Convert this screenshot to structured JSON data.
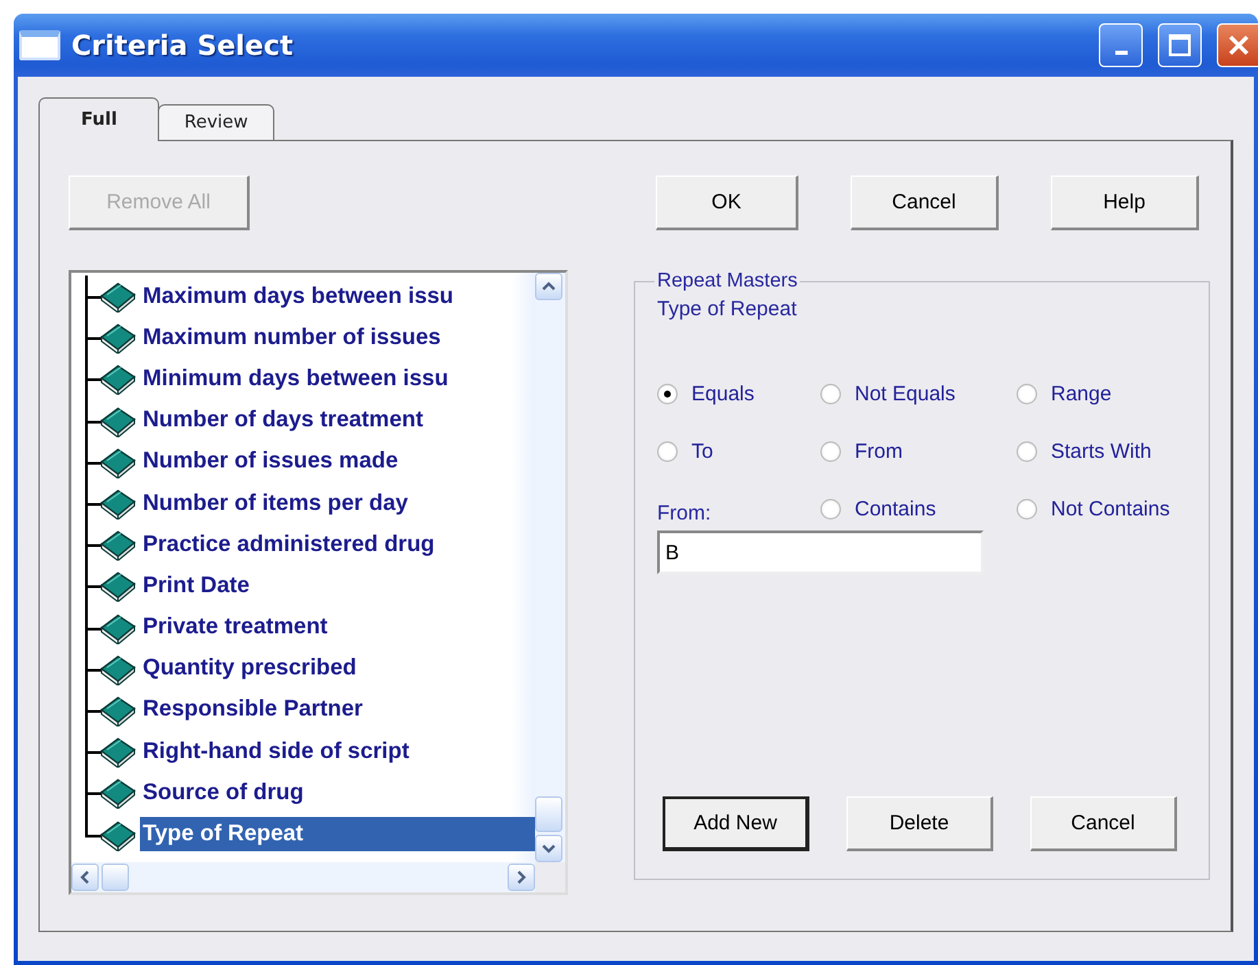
{
  "window": {
    "title": "Criteria Select"
  },
  "tabs": [
    {
      "label": "Full",
      "selected": true
    },
    {
      "label": "Review",
      "selected": false
    }
  ],
  "toolbar": {
    "remove_all": {
      "label": "Remove All",
      "disabled": true
    },
    "buttons": [
      "OK",
      "Cancel",
      "Help"
    ]
  },
  "tree": {
    "items": [
      {
        "label": "Maximum days between issu",
        "selected": false
      },
      {
        "label": "Maximum number of issues",
        "selected": false
      },
      {
        "label": "Minimum days between issu",
        "selected": false
      },
      {
        "label": "Number of days treatment",
        "selected": false
      },
      {
        "label": "Number of issues made",
        "selected": false
      },
      {
        "label": "Number of items per day",
        "selected": false
      },
      {
        "label": "Practice administered drug",
        "selected": false
      },
      {
        "label": "Print Date",
        "selected": false
      },
      {
        "label": "Private treatment",
        "selected": false
      },
      {
        "label": "Quantity prescribed",
        "selected": false
      },
      {
        "label": "Responsible Partner",
        "selected": false
      },
      {
        "label": "Right-hand side of script",
        "selected": false
      },
      {
        "label": "Source of drug",
        "selected": false
      },
      {
        "label": "Type of Repeat",
        "selected": true
      }
    ]
  },
  "group": {
    "title": "Repeat Masters",
    "subtitle": "Type of Repeat",
    "radio_columns": [
      [
        {
          "label": "Equals",
          "selected": true
        },
        {
          "label": "To",
          "selected": false
        }
      ],
      [
        {
          "label": "Not Equals",
          "selected": false
        },
        {
          "label": "From",
          "selected": false
        },
        {
          "label": "Contains",
          "selected": false
        }
      ],
      [
        {
          "label": "Range",
          "selected": false
        },
        {
          "label": "Starts With",
          "selected": false
        },
        {
          "label": "Not Contains",
          "selected": false
        }
      ]
    ],
    "field": {
      "label": "From:",
      "value": "B"
    },
    "buttons": [
      {
        "label": "Add New",
        "default": true
      },
      {
        "label": "Delete",
        "default": false
      },
      {
        "label": "Cancel",
        "default": false
      }
    ]
  }
}
